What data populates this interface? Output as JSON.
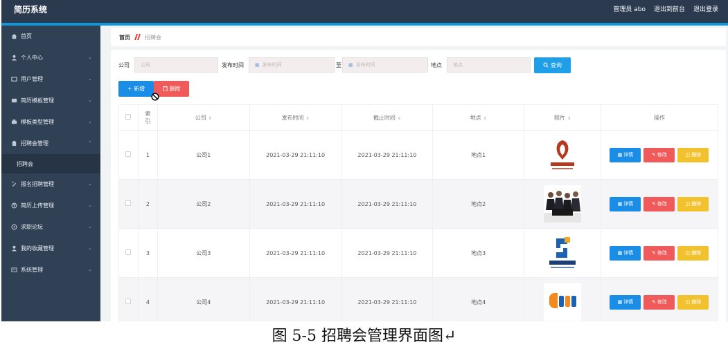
{
  "header": {
    "app_title": "简历系统",
    "admin_label": "管理员 abo",
    "back_label": "退出到前台",
    "logout_label": "退出登录"
  },
  "sidebar": {
    "items": [
      {
        "label": "首页",
        "icon": "home-icon"
      },
      {
        "label": "个人中心",
        "icon": "user-icon"
      },
      {
        "label": "用户管理",
        "icon": "users-icon"
      },
      {
        "label": "简历模板管理",
        "icon": "template-icon"
      },
      {
        "label": "模板类型管理",
        "icon": "type-icon"
      },
      {
        "label": "招聘会管理",
        "icon": "briefcase-icon",
        "expanded": true
      },
      {
        "label": "招聘会",
        "icon": "",
        "sub": true
      },
      {
        "label": "报名招聘管理",
        "icon": "signup-icon"
      },
      {
        "label": "简历上传管理",
        "icon": "upload-icon"
      },
      {
        "label": "求职论坛",
        "icon": "forum-icon"
      },
      {
        "label": "我的收藏管理",
        "icon": "star-icon"
      },
      {
        "label": "系统管理",
        "icon": "settings-icon"
      }
    ]
  },
  "breadcrumb": {
    "home": "首页",
    "current": "招聘会"
  },
  "search": {
    "company_label": "公司",
    "company_placeholder": "公司",
    "publish_label": "发布时间",
    "publish_placeholder": "发布时间",
    "to_label": "至",
    "publish_end_placeholder": "发布时间",
    "location_label": "地点",
    "location_placeholder": "地点",
    "query_label": "查询"
  },
  "actions": {
    "add_label": "+ 新增",
    "delete_label": "删除"
  },
  "table": {
    "columns": [
      "索引",
      "公司",
      "发布时间",
      "截止时间",
      "地点",
      "照片",
      "操作"
    ],
    "rows": [
      {
        "index": "1",
        "company": "公司1",
        "publish": "2021-03-29 21:11:10",
        "deadline": "2021-03-29 21:11:10",
        "location": "地点1",
        "photo": "logo-decor"
      },
      {
        "index": "2",
        "company": "公司2",
        "publish": "2021-03-29 21:11:10",
        "deadline": "2021-03-29 21:11:10",
        "location": "地点2",
        "photo": "people-meeting"
      },
      {
        "index": "3",
        "company": "公司3",
        "publish": "2021-03-29 21:11:10",
        "deadline": "2021-03-29 21:11:10",
        "location": "地点3",
        "photo": "logo-network"
      },
      {
        "index": "4",
        "company": "公司4",
        "publish": "2021-03-29 21:11:10",
        "deadline": "2021-03-29 21:11:10",
        "location": "地点4",
        "photo": "logo-alipay"
      }
    ],
    "op_detail": "详情",
    "op_edit": "修改",
    "op_delete": "删除"
  },
  "caption": "图 5-5 招聘会管理界面图↵",
  "colors": {
    "topbar": "#2b3a4f",
    "sidebar": "#304156",
    "accent": "#1296db",
    "primary": "#1a8ee6",
    "danger": "#f05a5a",
    "warning": "#f2c12e"
  }
}
